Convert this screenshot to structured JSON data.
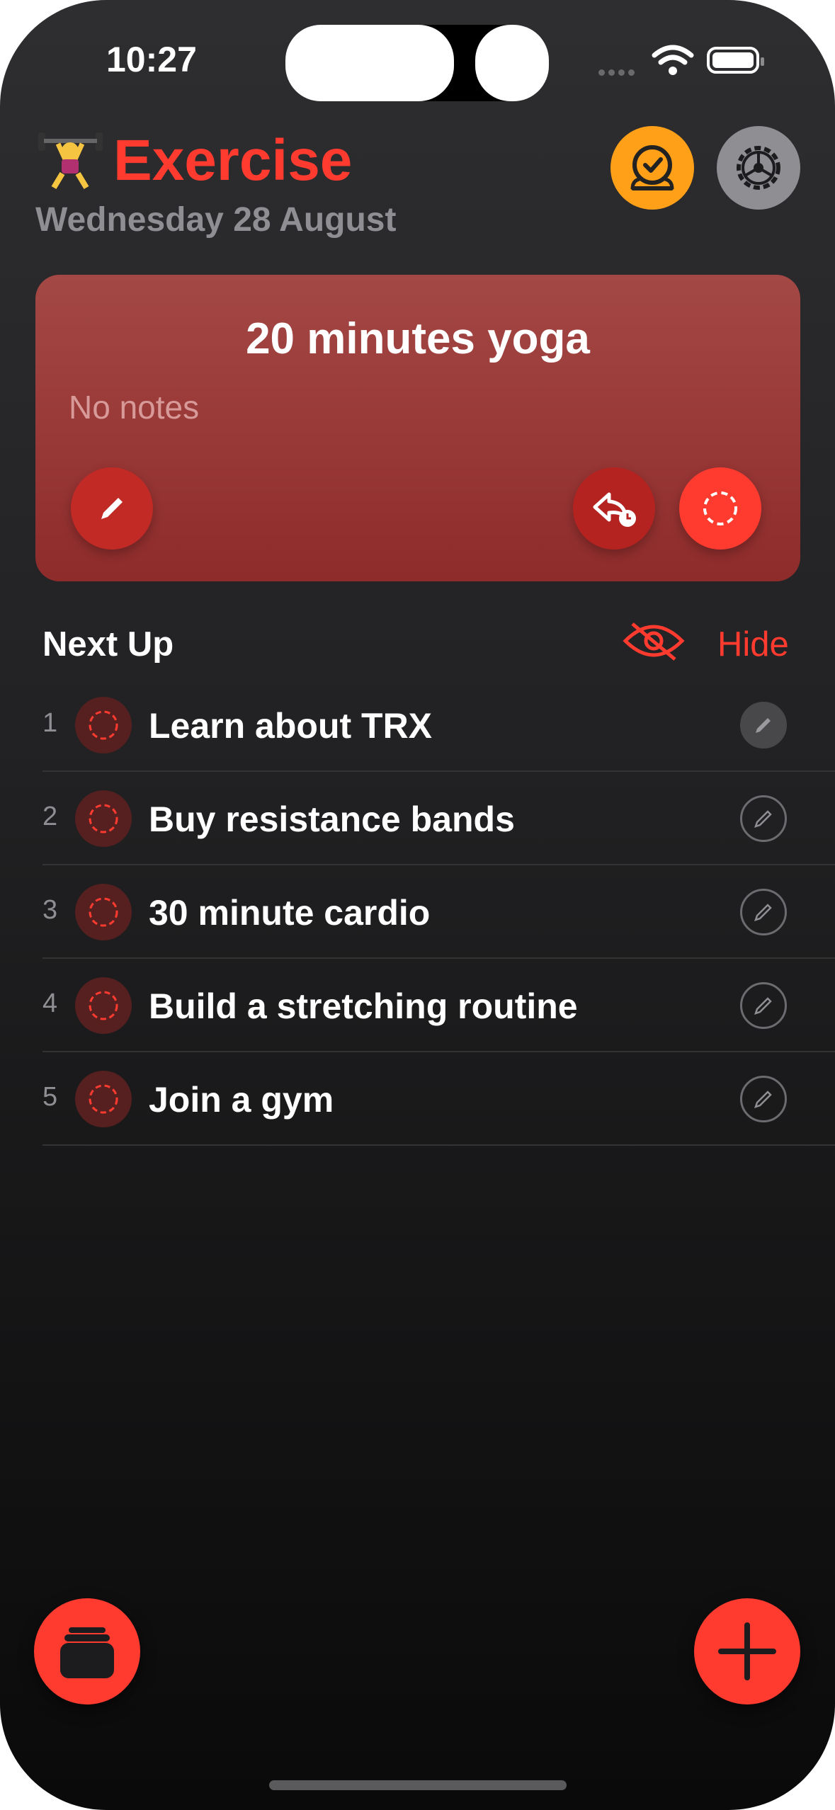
{
  "status_bar": {
    "time": "10:27"
  },
  "header": {
    "title": "Exercise",
    "date": "Wednesday 28 August",
    "icon": "weightlifter-emoji",
    "alarm_button_icon": "alarm-clock-icon",
    "settings_button_icon": "gear-icon"
  },
  "current_task": {
    "title": "20 minutes yoga",
    "notes": "No notes"
  },
  "next_up": {
    "heading": "Next Up",
    "hide_label": "Hide",
    "items": [
      {
        "index": "1",
        "label": "Learn about TRX"
      },
      {
        "index": "2",
        "label": "Buy resistance bands"
      },
      {
        "index": "3",
        "label": "30 minute cardio"
      },
      {
        "index": "4",
        "label": "Build a stretching routine"
      },
      {
        "index": "5",
        "label": "Join a gym"
      }
    ]
  },
  "colors": {
    "accent": "#ff3b30",
    "alarm": "#ffa018",
    "card": "#9a3a38",
    "text_secondary": "#8e8e93"
  }
}
